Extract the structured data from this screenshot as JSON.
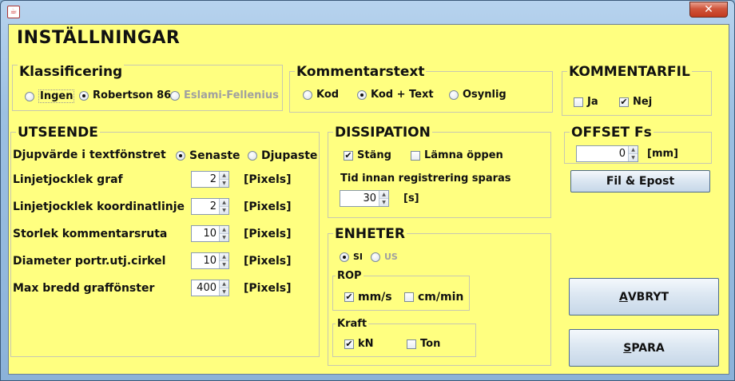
{
  "window": {
    "title": "",
    "close_glyph": "✕",
    "app_icon_glyph": "☕"
  },
  "page_title": "INSTÄLLNINGAR",
  "klassificering": {
    "title": "Klassificering",
    "options": [
      {
        "label": "Ingen",
        "selected": false,
        "enabled": true
      },
      {
        "label": "Robertson 86",
        "selected": true,
        "enabled": true
      },
      {
        "label": "Eslami-Fellenius",
        "selected": false,
        "enabled": false
      }
    ]
  },
  "kommentarstext": {
    "title": "Kommentarstext",
    "options": [
      {
        "label": "Kod",
        "selected": false
      },
      {
        "label": "Kod + Text",
        "selected": true
      },
      {
        "label": "Osynlig",
        "selected": false
      }
    ]
  },
  "kommentarfil": {
    "title": "KOMMENTARFIL",
    "options": [
      {
        "label": "Ja",
        "checked": false
      },
      {
        "label": "Nej",
        "checked": true
      }
    ]
  },
  "utseende": {
    "title": "UTSEENDE",
    "depth_label": "Djupvärde i textfönstret",
    "depth_options": [
      {
        "label": "Senaste",
        "selected": true
      },
      {
        "label": "Djupaste",
        "selected": false
      }
    ],
    "rows": [
      {
        "label": "Linjetjocklek graf",
        "value": "2",
        "unit": "[Pixels]"
      },
      {
        "label": "Linjetjocklek koordinatlinje",
        "value": "2",
        "unit": "[Pixels]"
      },
      {
        "label": "Storlek kommentarsruta",
        "value": "10",
        "unit": "[Pixels]"
      },
      {
        "label": "Diameter portr.utj.cirkel",
        "value": "10",
        "unit": "[Pixels]"
      },
      {
        "label": "Max bredd graffönster",
        "value": "400",
        "unit": "[Pixels]"
      }
    ]
  },
  "dissipation": {
    "title": "DISSIPATION",
    "options": [
      {
        "label": "Stäng",
        "checked": true
      },
      {
        "label": "Lämna öppen",
        "checked": false
      }
    ],
    "time_label": "Tid innan registrering sparas",
    "time_value": "30",
    "time_unit": "[s]"
  },
  "offset": {
    "title": "OFFSET Fs",
    "value": "0",
    "unit": "[mm]",
    "button_label": "Fil & Epost"
  },
  "enheter": {
    "title": "ENHETER",
    "systems": [
      {
        "label": "SI",
        "selected": true,
        "enabled": true
      },
      {
        "label": "US",
        "selected": false,
        "enabled": false
      }
    ],
    "rop": {
      "title": "ROP",
      "options": [
        {
          "label": "mm/s",
          "checked": true
        },
        {
          "label": "cm/min",
          "checked": false
        }
      ]
    },
    "kraft": {
      "title": "Kraft",
      "options": [
        {
          "label": "kN",
          "checked": true
        },
        {
          "label": "Ton",
          "checked": false
        }
      ]
    }
  },
  "buttons": {
    "avbryt_mnemonic": "A",
    "avbryt_rest": "VBRYT",
    "spara_mnemonic": "S",
    "spara_rest": "PARA"
  },
  "colors": {
    "panel_background": "#ffff80",
    "window_frame": "#9cc0e2",
    "close_button": "#c23a1f"
  }
}
